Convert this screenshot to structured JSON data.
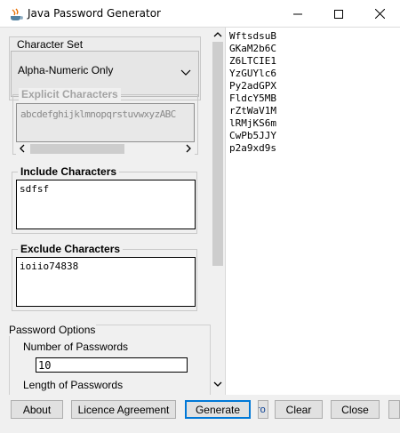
{
  "window": {
    "title": "Java Password Generator"
  },
  "character_set": {
    "label": "Character Set",
    "selected": "Alpha-Numeric Only"
  },
  "explicit_characters": {
    "label": "Explicit Characters",
    "value": "abcdefghijklmnopqrstuvwxyzABC"
  },
  "include_characters": {
    "label": "Include Characters",
    "value": "sdfsf"
  },
  "exclude_characters": {
    "label": "Exclude Characters",
    "value": "ioiio74838"
  },
  "password_options": {
    "title": "Password Options",
    "number_label": "Number of Passwords",
    "number_value": "10",
    "length_label": "Length of Passwords"
  },
  "passwords": [
    "WftsdsuB",
    "GKaM2b6C",
    "Z6LTCIE1",
    "YzGUYlc6",
    "Py2adGPX",
    "FldcY5MB",
    "rZtWaV1M",
    "lRMjKS6m",
    "CwPb5JJY",
    "p2a9xd9s"
  ],
  "buttons": {
    "about": "About",
    "licence": "Licence Agreement",
    "generate": "Generate",
    "partial": "ro",
    "clear": "Clear",
    "close": "Close"
  }
}
